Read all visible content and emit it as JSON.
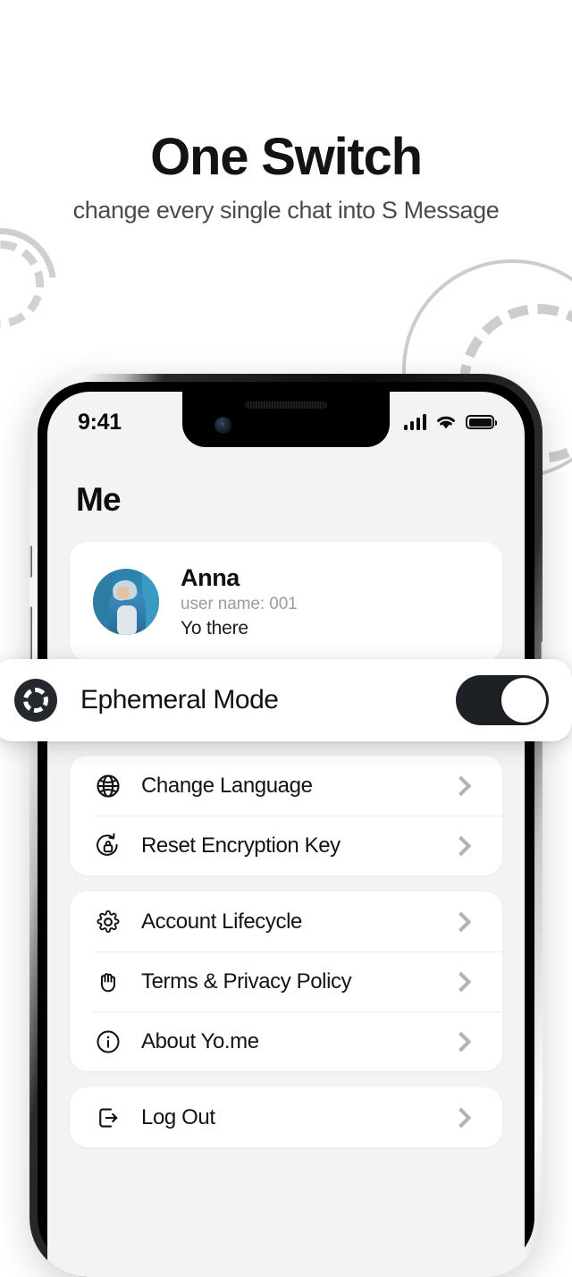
{
  "promo": {
    "headline": "One Switch",
    "subhead": "change every single chat into S Message"
  },
  "statusbar": {
    "time": "9:41",
    "cellular_icon": "signal-bars-icon",
    "wifi_icon": "wifi-icon",
    "battery_icon": "battery-icon"
  },
  "screen": {
    "title": "Me",
    "profile": {
      "name": "Anna",
      "username": "user name: 001",
      "status": "Yo there"
    },
    "highlight_row": {
      "label": "Ephemeral Mode",
      "icon": "ephemeral-dashed-circle-icon",
      "toggle_state": "on"
    },
    "groups": [
      {
        "rows": [
          {
            "label": "Change Language",
            "icon": "globe-icon"
          },
          {
            "label": "Reset Encryption Key",
            "icon": "reset-lock-icon"
          }
        ]
      },
      {
        "rows": [
          {
            "label": "Account Lifecycle",
            "icon": "gear-icon"
          },
          {
            "label": "Terms & Privacy Policy",
            "icon": "hand-icon"
          },
          {
            "label": "About Yo.me",
            "icon": "info-circle-icon"
          }
        ]
      },
      {
        "rows": [
          {
            "label": "Log Out",
            "icon": "logout-icon"
          }
        ]
      }
    ]
  },
  "colors": {
    "page_bg": "#ffffff",
    "screen_bg": "#f2f3f5",
    "card_bg": "#ffffff",
    "accent_dark": "#1d2024",
    "chevron": "#b2b2b7",
    "muted_text": "#9b9ba0",
    "decor": "#cccccc"
  }
}
